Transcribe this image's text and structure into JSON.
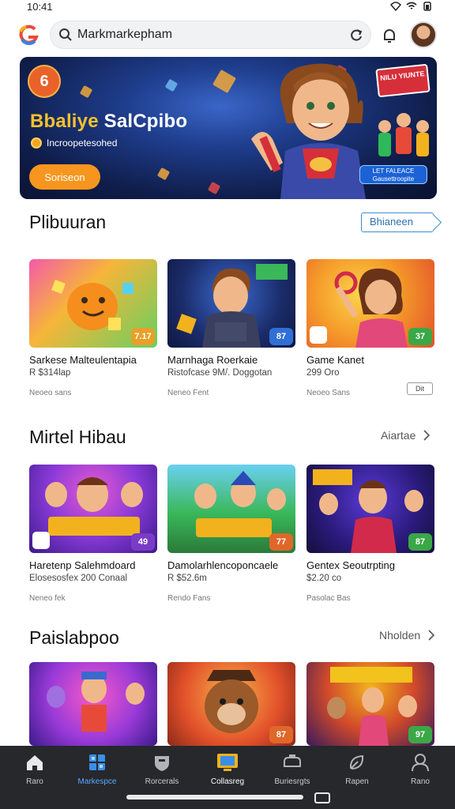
{
  "status": {
    "time": "10:41"
  },
  "search": {
    "value": "",
    "placeholder": "Markmarkepham"
  },
  "hero": {
    "badge": "6",
    "title_part1": "Bbaliye",
    "title_part2": "SalCpibo",
    "subtitle": "Incroopetesohed",
    "button_label": "Soriseon",
    "sticker_text": "NILU YIUNTE",
    "tag_text": "LET FALEACE Gausettroopite"
  },
  "sections": [
    {
      "title": "Plibuuran",
      "action": "Bhianeen",
      "cards": [
        {
          "title": "Sarkese Malteulentapia",
          "meta": "R $314lap",
          "sub": "Neoeo sans",
          "score": "7.17",
          "score_color": "#e8a02a"
        },
        {
          "title": "Marnhaga Roerkaie",
          "meta": "Ristofcase  9M/. Doggotan",
          "sub": "Neneo Fent",
          "score": "87",
          "score_color": "#2f6fd6"
        },
        {
          "title": "Game Kanet",
          "meta": "299 Oro",
          "sub": "Neoeo Sans",
          "score": "37",
          "score_color": "#3aa846",
          "chip": "Dit"
        }
      ]
    },
    {
      "title": "Mirtel Hibau",
      "action": "Aiartae",
      "cards": [
        {
          "title": "Haretenp Salehmdoard",
          "meta": "Elosesosfex  200 Conaal",
          "sub": "Neneo fek",
          "score": "49",
          "score_color": "#7a3cc8"
        },
        {
          "title": "Damolarhlencoponcaele",
          "meta": "R $52.6m",
          "sub": "Rendo Fans",
          "score": "77",
          "score_color": "#e0672a"
        },
        {
          "title": "Gentex Seoutrpting",
          "meta": "$2.20 co",
          "sub": "Pasolac Bas",
          "score": "87",
          "score_color": "#3aa846"
        }
      ]
    },
    {
      "title": "Paislabpoo",
      "action": "Nholden",
      "cards": [
        {
          "score": "",
          "score_color": ""
        },
        {
          "score": "87",
          "score_color": "#e0672a"
        },
        {
          "score": "97",
          "score_color": "#3aa846"
        }
      ]
    }
  ],
  "nav": [
    {
      "label": "Raro",
      "icon": "home-icon"
    },
    {
      "label": "Markespce",
      "icon": "grid-icon",
      "active": true
    },
    {
      "label": "Rorcerals",
      "icon": "shield-icon"
    },
    {
      "label": "Collasreg",
      "icon": "monitor-icon"
    },
    {
      "label": "Buriesrgts",
      "icon": "controller-icon"
    },
    {
      "label": "Rapen",
      "icon": "leaf-icon"
    },
    {
      "label": "Rano",
      "icon": "profile-icon"
    }
  ],
  "colors": {
    "accent_blue": "#5da8ff",
    "hero_orange": "#f7961f",
    "nav_bg": "#26282c"
  }
}
